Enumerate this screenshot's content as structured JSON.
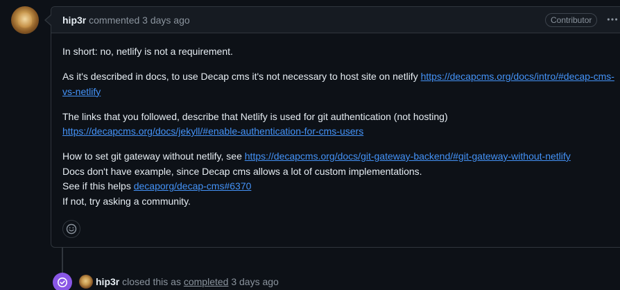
{
  "comment": {
    "author": "hip3r",
    "action": "commented",
    "time": "3 days ago",
    "role_badge": "Contributor",
    "more_icon": "kebab-horizontal-icon",
    "paragraphs": {
      "p1": "In short: no, netlify is not a requirement.",
      "p2_text": "As it's described in docs, to use Decap cms it's not necessary to host site on netlify ",
      "p2_link": "https://decapcms.org/docs/intro/#decap-cms-vs-netlify",
      "p3_text": "The links that you followed, describe that Netlify is used for git authentication (not hosting)",
      "p3_link": "https://decapcms.org/docs/jekyll/#enable-authentication-for-cms-users",
      "p4_line1_text": "How to set git gateway without netlify, see ",
      "p4_line1_link": "https://decapcms.org/docs/git-gateway-backend/#git-gateway-without-netlify",
      "p4_line2": "Docs don't have example, since Decap cms allows a lot of custom implementations.",
      "p4_line3_text": "See if this helps ",
      "p4_line3_link": "decaporg/decap-cms#6370",
      "p4_line4": "If not, try asking a community."
    },
    "reaction_icon": "smiley-icon"
  },
  "event": {
    "icon": "check-circle-icon",
    "author": "hip3r",
    "action": "closed this as",
    "state": "completed",
    "time": "3 days ago"
  },
  "colors": {
    "background": "#0d1117",
    "header_bg": "#161b22",
    "border": "#30363d",
    "link": "#4493f8",
    "muted": "#8b949e",
    "text": "#e6edf3",
    "closed_badge": "#8957e5"
  }
}
